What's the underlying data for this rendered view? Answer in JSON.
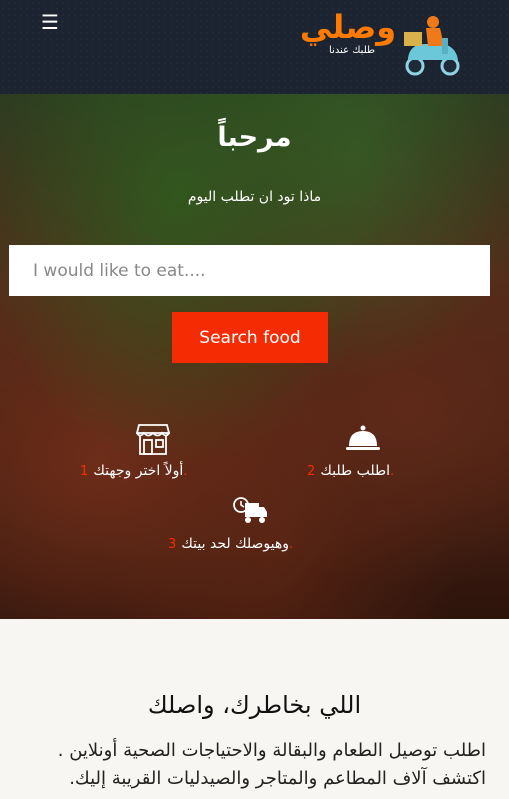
{
  "header": {
    "menu_icon": "hamburger-icon",
    "logo_text": "وصلي",
    "logo_tagline": "طلبك عندنا"
  },
  "hero": {
    "welcome": "مرحباً",
    "subtitle": "ماذا تود ان تطلب اليوم",
    "search_placeholder": "I would like to eat....",
    "search_button": "Search food",
    "steps": [
      {
        "icon": "storefront-icon",
        "label": "أولاً  اختر  وجهتك",
        "num": "1."
      },
      {
        "icon": "serving-dish-icon",
        "label": "اطلب  طلبك",
        "num": "2."
      },
      {
        "icon": "delivery-truck-icon",
        "label": "وهيوصلك  لحد  بيتك",
        "num": "3."
      }
    ]
  },
  "about": {
    "title": "اللي بخاطرك، واصلك",
    "text": "اطلب توصيل الطعام والبقالة والاحتياجات الصحية أونلاين . اكتشف آلاف المطاعم والمتاجر والصيدليات القريبة إليك."
  },
  "colors": {
    "accent": "#f52c03",
    "header_bg": "#1c2431",
    "logo_orange": "#ff7a00"
  }
}
